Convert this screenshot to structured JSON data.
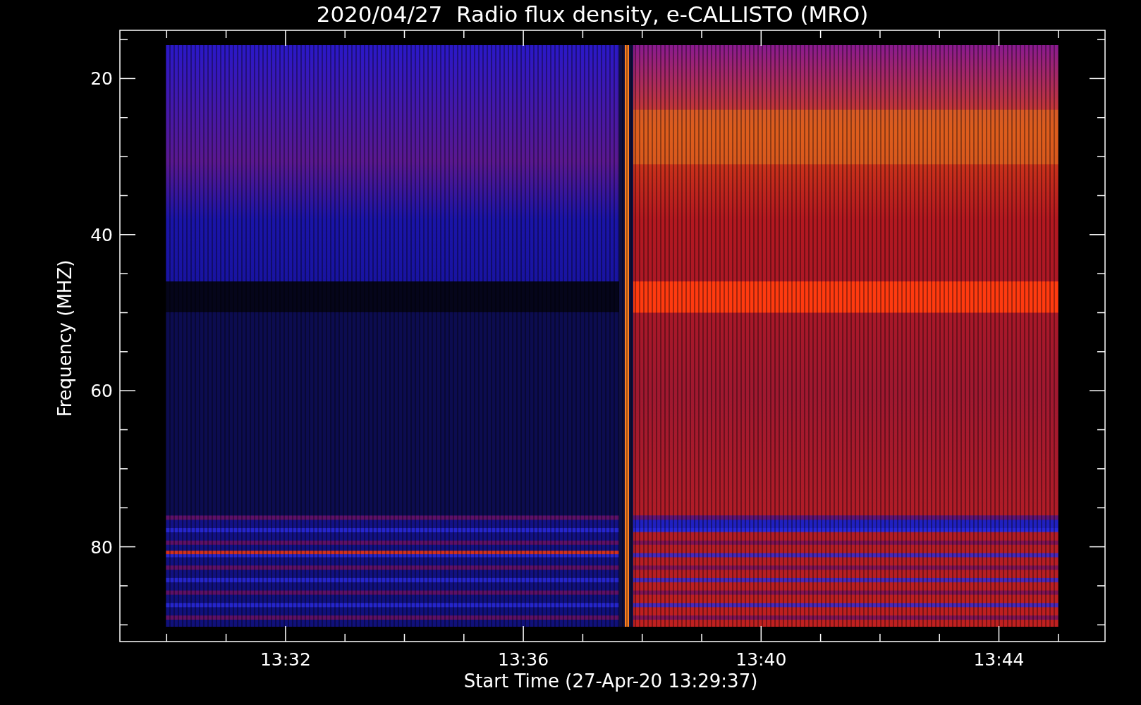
{
  "title": "2020/04/27  Radio flux density, e-CALLISTO (MRO)",
  "y_axis": {
    "label": "Frequency (MHZ)",
    "ticks": [
      "20",
      "40",
      "60",
      "80"
    ]
  },
  "x_axis": {
    "label": "Start Time (27-Apr-20 13:29:37)",
    "ticks": [
      "13:32",
      "13:36",
      "13:40",
      "13:44"
    ]
  }
}
